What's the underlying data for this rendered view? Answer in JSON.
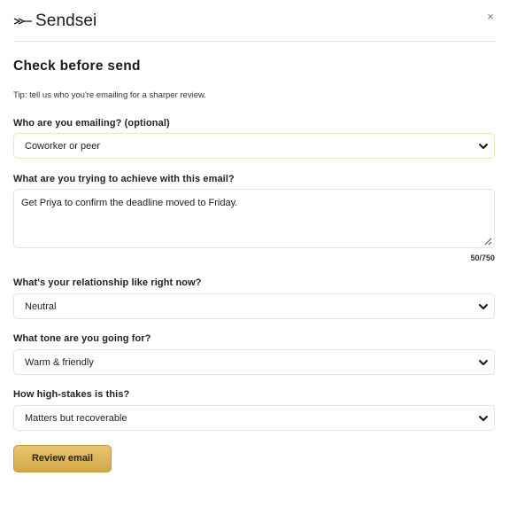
{
  "header": {
    "brand": "Sendsei",
    "logo_icon": "scissors-logo-icon",
    "close_label": "×"
  },
  "main": {
    "title": "Check before send",
    "tip": "Tip: tell us who you're emailing for a sharper review.",
    "recipient": {
      "label": "Who are you emailing? (optional)",
      "value": "Coworker or peer"
    },
    "goal": {
      "label": "What are you trying to achieve with this email?",
      "value": "Get Priya to confirm the deadline moved to Friday.",
      "counter": "50/750"
    },
    "relationship": {
      "label": "What's your relationship like right now?",
      "value": "Neutral"
    },
    "tone": {
      "label": "What tone are you going for?",
      "value": "Warm & friendly"
    },
    "stakes": {
      "label": "How high-stakes is this?",
      "value": "Matters but recoverable"
    },
    "review_button": "Review email"
  },
  "colors": {
    "accent": "#d9b055",
    "accent_border": "#c49a3c",
    "field_border": "#e3e3e3"
  }
}
